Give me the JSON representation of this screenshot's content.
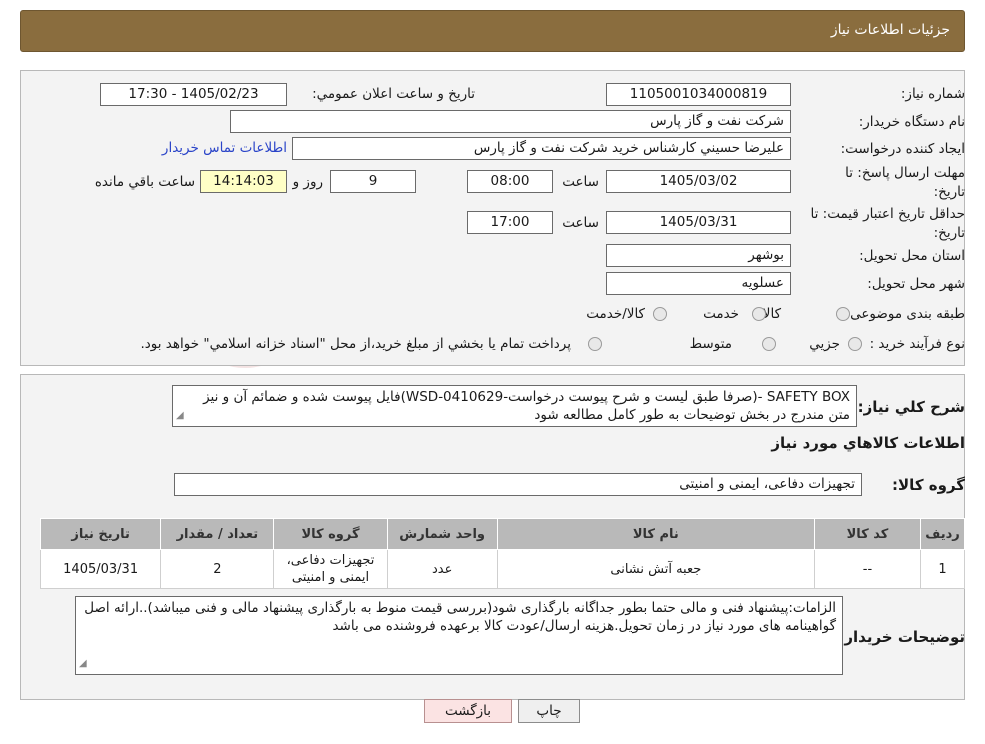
{
  "header": {
    "title": "جزئیات اطلاعات نیاز"
  },
  "fields": {
    "need_number_label": "شماره نیاز:",
    "need_number": "1105001034000819",
    "announce_label": "تاریخ و ساعت اعلان عمومي:",
    "announce_value": "1405/02/23 - 17:30",
    "buyer_label": "نام دستگاه خريدار:",
    "buyer_value": "شرکت نفت و گاز پارس",
    "creator_label": "ايجاد کننده درخواست:",
    "creator_value": "عليرضا حسيني کارشناس خريد شرکت نفت و گاز پارس",
    "contact_link": "اطلاعات تماس خريدار",
    "deadline_label_1": "مهلت ارسال پاسخ: تا",
    "deadline_label_2": "تاريخ:",
    "deadline_date": "1405/03/02",
    "time_label": "ساعت",
    "deadline_time": "08:00",
    "days_value": "9",
    "days_label": "روز و",
    "remaining_value": "14:14:03",
    "remaining_label": "ساعت باقي مانده",
    "validity_label_1": "حداقل تاريخ اعتبار قيمت: تا",
    "validity_label_2": "تاريخ:",
    "validity_date": "1405/03/31",
    "validity_time": "17:00",
    "province_label": "استان محل تحويل:",
    "province_value": "بوشهر",
    "city_label": "شهر محل تحويل:",
    "city_value": "عسلويه",
    "category_label": "طبقه بندی موضوعی:",
    "category_options": [
      "کالا",
      "خدمت",
      "کالا/خدمت"
    ],
    "process_label": "نوع فرآيند خريد :",
    "process_options": [
      "جزيي",
      "متوسط"
    ],
    "process_note": "پرداخت تمام يا بخشي از مبلغ خريد،از محل \"اسناد خزانه اسلامي\" خواهد بود."
  },
  "description": {
    "label": "شرح كلي نياز:",
    "text": "SAFETY BOX -(صرفا طبق ليست و شرح پيوست درخواست-WSD-0410629)فايل پيوست شده و ضمائم آن و نيز متن مندرج در بخش توضيحات به طور کامل مطالعه شود"
  },
  "goods": {
    "title": "اطلاعات كالاهاي مورد نياز",
    "group_label": "گروه كالا:",
    "group_value": "تجهيزات دفاعی، ايمنی و امنيتی",
    "columns": [
      "رديف",
      "کد کالا",
      "نام کالا",
      "واحد شمارش",
      "گروه کالا",
      "تعداد / مقدار",
      "تاريخ نياز"
    ],
    "rows": [
      [
        "1",
        "--",
        "جعبه آتش نشانی",
        "عدد",
        "تجهيزات دفاعی، ايمنی و امنيتی",
        "2",
        "1405/03/31"
      ]
    ]
  },
  "notes": {
    "label": "توضيحات خريدار:",
    "text": "الزامات:پيشنهاد فنی و مالی حتما  بطور جداگانه بارگذاری شود(بررسی قيمت منوط به بارگذاری پيشنهاد مالی و فنی ميباشد)..ارائه اصل گواهينامه های مورد نياز در زمان تحويل.هزينه ارسال/عودت کالا برعهده فروشنده می باشد"
  },
  "buttons": {
    "print": "چاپ",
    "back": "بازگشت"
  },
  "watermark": {
    "text": "AriaTender.neT"
  }
}
